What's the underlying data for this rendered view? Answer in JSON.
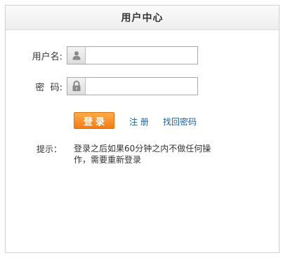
{
  "header": {
    "title": "用户中心"
  },
  "form": {
    "username": {
      "label": "用户名:",
      "value": "",
      "icon": "user-icon"
    },
    "password": {
      "label": "密  码:",
      "value": "",
      "icon": "lock-icon"
    },
    "login_label": "登录",
    "register_label": "注 册",
    "recover_label": "找回密码"
  },
  "tip": {
    "label": "提示：",
    "text": "登录之后如果60分钟之内不做任何操作，需要重新登录"
  },
  "colors": {
    "login_button": "#f27d12",
    "link": "#1a5fa8",
    "border": "#cfcfcf"
  }
}
